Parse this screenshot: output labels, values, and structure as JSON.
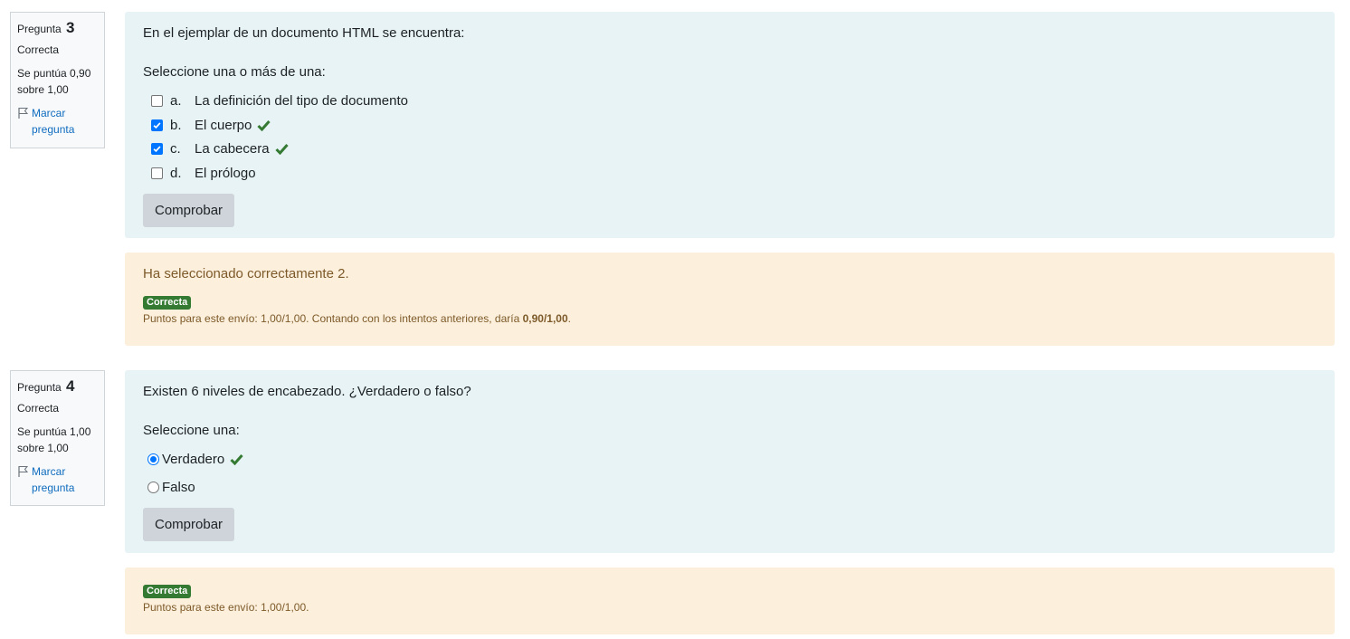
{
  "colors": {
    "question_bg": "#e7f3f5",
    "feedback_bg": "#fcefdc",
    "badge_green": "#357a32",
    "check_green": "#357a32",
    "link_blue": "#0f6cbf"
  },
  "questions": [
    {
      "info": {
        "label": "Pregunta",
        "number": "3",
        "state": "Correcta",
        "grade": "Se puntúa 0,90 sobre 1,00",
        "flag": "Marcar pregunta"
      },
      "text": "En el ejemplar de un documento HTML se encuentra:",
      "prompt": "Seleccione una o más de una:",
      "options": [
        {
          "letter": "a.",
          "label": "La definición del tipo de documento",
          "checked": false,
          "correct_mark": false
        },
        {
          "letter": "b.",
          "label": "El cuerpo",
          "checked": true,
          "correct_mark": true
        },
        {
          "letter": "c.",
          "label": "La cabecera",
          "checked": true,
          "correct_mark": true
        },
        {
          "letter": "d.",
          "label": "El prólogo",
          "checked": false,
          "correct_mark": false
        }
      ],
      "button": "Comprobar",
      "feedback": {
        "message": "Ha seleccionado correctamente 2.",
        "badge": "Correcta",
        "points": "Puntos para este envío: 1,00/1,00. Contando con los intentos anteriores, daría ",
        "points_bold": "0,90/1,00",
        "points_end": "."
      }
    },
    {
      "info": {
        "label": "Pregunta",
        "number": "4",
        "state": "Correcta",
        "grade": "Se puntúa 1,00 sobre 1,00",
        "flag": "Marcar pregunta"
      },
      "text": "Existen 6 niveles de encabezado. ¿Verdadero o falso?",
      "prompt": "Seleccione una:",
      "options": [
        {
          "label": "Verdadero",
          "checked": true,
          "correct_mark": true
        },
        {
          "label": "Falso",
          "checked": false,
          "correct_mark": false
        }
      ],
      "button": "Comprobar",
      "feedback": {
        "badge": "Correcta",
        "points": "Puntos para este envío: 1,00/1,00."
      }
    }
  ]
}
